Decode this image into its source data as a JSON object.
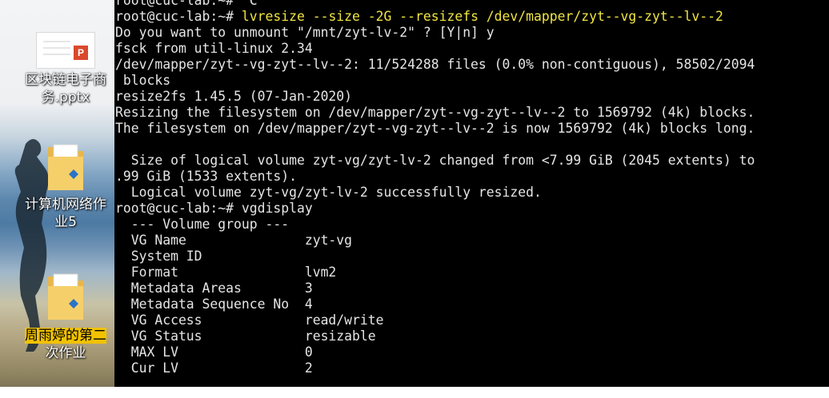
{
  "desktop": {
    "icons": [
      {
        "name": "pptx-file",
        "label": "区块链电子商务.pptx",
        "label_line1": "区块链电子商",
        "label_line2": "务.pptx",
        "thumb_badge": "P"
      },
      {
        "name": "folder-network",
        "label": "计算机网络作业5",
        "label_line1": "计算机网络作",
        "label_line2": "业5"
      },
      {
        "name": "folder-homework",
        "label": "周雨婷的第二次作业",
        "label_line1": "周雨婷的第二",
        "label_line2": "次作业"
      }
    ]
  },
  "terminal": {
    "lines": [
      {
        "text": "root@cuc-lab:~# ^C",
        "kind": "prompt"
      },
      {
        "prompt": "root@cuc-lab:~# ",
        "command": "lvresize --size -2G --resizefs /dev/mapper/zyt--vg-zyt--lv--2",
        "kind": "command"
      },
      {
        "text": "Do you want to unmount \"/mnt/zyt-lv-2\" ? [Y|n] y",
        "kind": "output"
      },
      {
        "text": "fsck from util-linux 2.34",
        "kind": "output"
      },
      {
        "text": "/dev/mapper/zyt--vg-zyt--lv--2: 11/524288 files (0.0% non-contiguous), 58502/2094",
        "kind": "output"
      },
      {
        "text": " blocks",
        "kind": "output"
      },
      {
        "text": "resize2fs 1.45.5 (07-Jan-2020)",
        "kind": "output"
      },
      {
        "text": "Resizing the filesystem on /dev/mapper/zyt--vg-zyt--lv--2 to 1569792 (4k) blocks.",
        "kind": "output"
      },
      {
        "text": "The filesystem on /dev/mapper/zyt--vg-zyt--lv--2 is now 1569792 (4k) blocks long.",
        "kind": "output"
      },
      {
        "text": "",
        "kind": "output"
      },
      {
        "text": "  Size of logical volume zyt-vg/zyt-lv-2 changed from <7.99 GiB (2045 extents) to",
        "kind": "output"
      },
      {
        "text": ".99 GiB (1533 extents).",
        "kind": "output"
      },
      {
        "text": "  Logical volume zyt-vg/zyt-lv-2 successfully resized.",
        "kind": "output"
      },
      {
        "text": "root@cuc-lab:~# vgdisplay",
        "kind": "prompt"
      },
      {
        "text": "  --- Volume group ---",
        "kind": "output"
      },
      {
        "text": "  VG Name               zyt-vg",
        "kind": "output"
      },
      {
        "text": "  System ID",
        "kind": "output"
      },
      {
        "text": "  Format                lvm2",
        "kind": "output"
      },
      {
        "text": "  Metadata Areas        3",
        "kind": "output"
      },
      {
        "text": "  Metadata Sequence No  4",
        "kind": "output"
      },
      {
        "text": "  VG Access             read/write",
        "kind": "output"
      },
      {
        "text": "  VG Status             resizable",
        "kind": "output"
      },
      {
        "text": "  MAX LV                0",
        "kind": "output"
      },
      {
        "text": "  Cur LV                2",
        "kind": "output"
      }
    ]
  },
  "colors": {
    "terminal_bg": "#000000",
    "terminal_fg": "#e5e5e5",
    "command_fg": "#f0e442",
    "label_highlight": "#f2c200"
  }
}
